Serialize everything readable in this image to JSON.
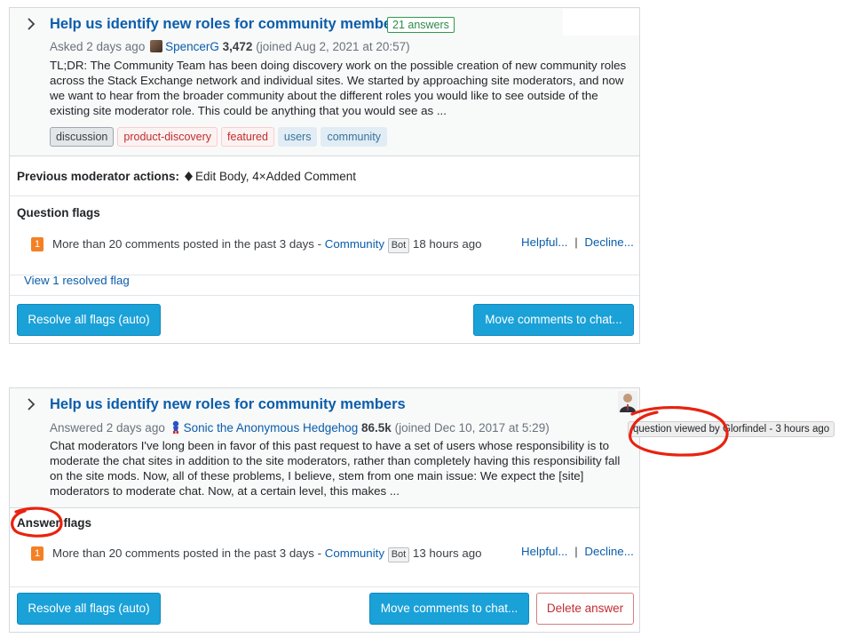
{
  "question_card": {
    "title": "Help us identify new roles for community members",
    "answers_badge": "21 answers",
    "meta": {
      "asked": "Asked 2 days ago",
      "user": "SpencerG",
      "rep": "3,472",
      "joined": "(joined Aug 2, 2021 at 20:57)"
    },
    "excerpt": "TL;DR: The Community Team has been doing discovery work on the possible creation of new community roles across the Stack Exchange network and individual sites. We started by approaching site moderators, and now we want to hear from the broader community about the different roles you would like to see outside of the existing site moderator role. This could be anything that you would see as ...",
    "tags": [
      "discussion",
      "product-discovery",
      "featured",
      "users",
      "community"
    ],
    "mod_actions_label": "Previous moderator actions:",
    "mod_actions_value": "Edit Body, 4×Added Comment",
    "flags_heading": "Question flags",
    "flag": {
      "count": "1",
      "text": "More than 20 comments posted in the past 3 days -",
      "user": "Community",
      "bot": "Bot",
      "time": "18 hours ago",
      "helpful": "Helpful...",
      "sep": "|",
      "decline": "Decline..."
    },
    "resolved_link": "View 1 resolved flag",
    "resolve_button": "Resolve all flags (auto)",
    "move_button": "Move comments to chat..."
  },
  "answer_card": {
    "title": "Help us identify new roles for community members",
    "meta": {
      "answered": "Answered 2 days ago",
      "user": "Sonic the Anonymous Hedgehog",
      "rep": "86.5k",
      "joined": "(joined Dec 10, 2017 at 5:29)"
    },
    "excerpt": "Chat moderators I've long been in favor of this past request to have a set of users whose responsibility is to moderate the chat sites in addition to the site moderators, rather than completely having this responsibility fall on the site mods. Now, all of these problems, I believe, stem from one main issue: We expect the [site] moderators to moderate chat. Now, at a certain level, this makes ...",
    "flags_heading": "Answer flags",
    "flag": {
      "count": "1",
      "text": "More than 20 comments posted in the past 3 days -",
      "user": "Community",
      "bot": "Bot",
      "time": "13 hours ago",
      "helpful": "Helpful...",
      "sep": "|",
      "decline": "Decline..."
    },
    "resolve_button": "Resolve all flags (auto)",
    "move_button": "Move comments to chat...",
    "delete_button": "Delete answer"
  },
  "tooltip": "question viewed by Glorfindel - 3 hours ago",
  "icons": [
    "chevron-right-icon",
    "diamond-icon",
    "user-avatar",
    "sonic-avatar",
    "viewer-avatar"
  ],
  "colors": {
    "link": "#0a5dab",
    "button": "#1aa1d8",
    "flag_badge": "#f48024",
    "danger": "#c22e32",
    "annotation": "#e8220f"
  }
}
